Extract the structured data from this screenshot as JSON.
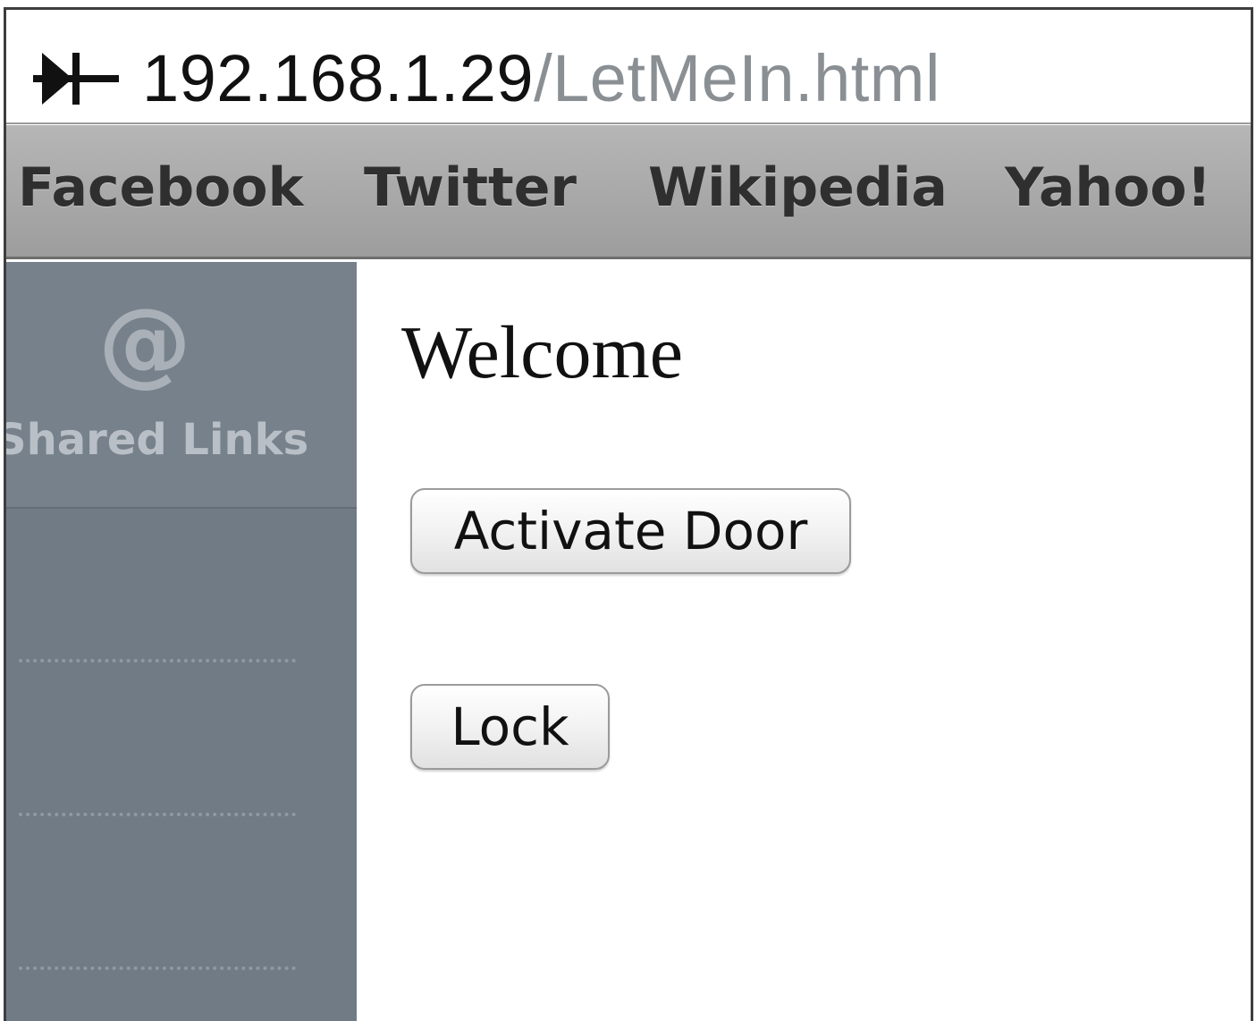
{
  "address_bar": {
    "host": "192.168.1.29",
    "path": "/LetMeIn.html",
    "site_icon": "network-device-icon"
  },
  "bookmarks": [
    {
      "label": "Facebook"
    },
    {
      "label": "Twitter"
    },
    {
      "label": "Wikipedia"
    },
    {
      "label": "Yahoo!"
    }
  ],
  "sidebar": {
    "icon": "at-sign-icon",
    "icon_glyph": "@",
    "label": "Shared Links"
  },
  "main": {
    "heading": "Welcome",
    "buttons": [
      {
        "label": "Activate Door"
      },
      {
        "label": "Lock"
      }
    ]
  }
}
